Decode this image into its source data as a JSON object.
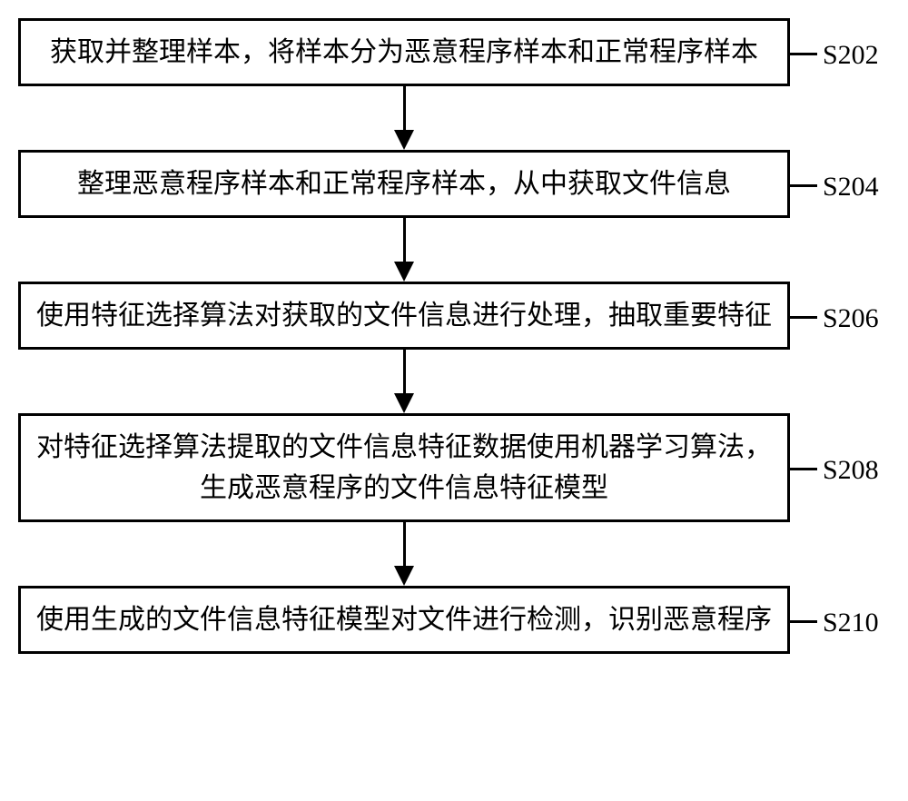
{
  "flowchart": {
    "steps": [
      {
        "text": "获取并整理样本，将样本分为恶意程序样本和正常程序样本",
        "label": "S202"
      },
      {
        "text": "整理恶意程序样本和正常程序样本，从中获取文件信息",
        "label": "S204"
      },
      {
        "text": "使用特征选择算法对获取的文件信息进行处理，抽取重要特征",
        "label": "S206"
      },
      {
        "text": "对特征选择算法提取的文件信息特征数据使用机器学习算法，生成恶意程序的文件信息特征模型",
        "label": "S208"
      },
      {
        "text": "使用生成的文件信息特征模型对文件进行检测，识别恶意程序",
        "label": "S210"
      }
    ]
  }
}
